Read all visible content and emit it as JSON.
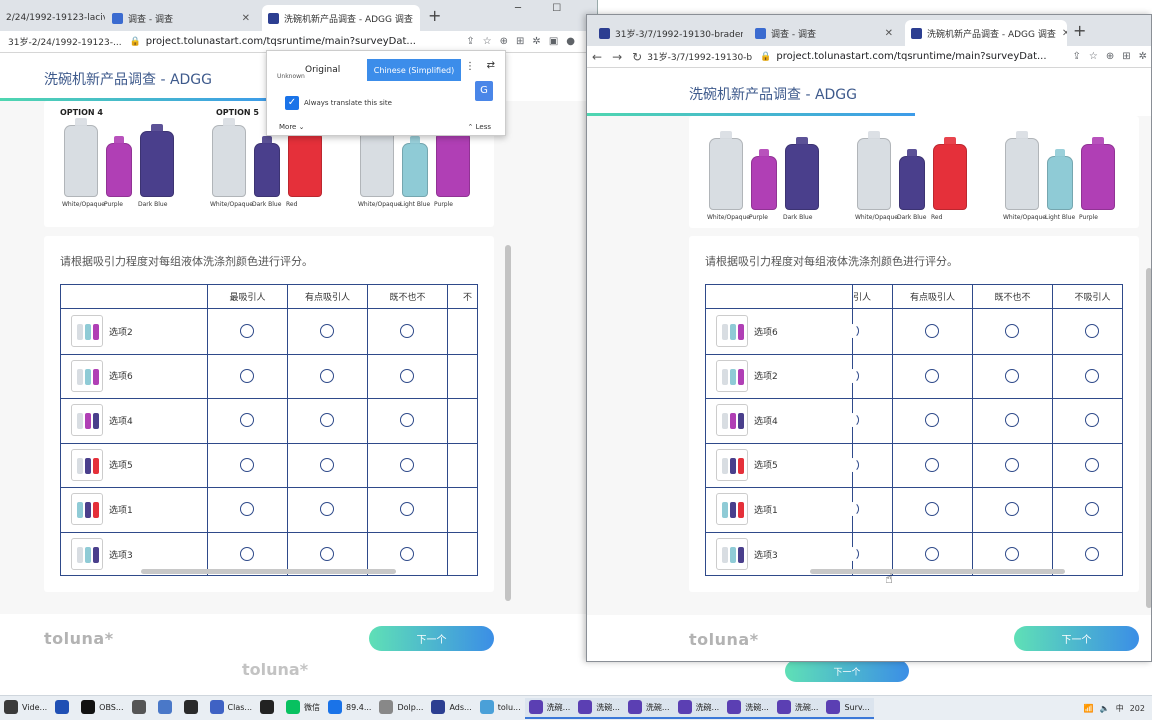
{
  "left_window": {
    "tabs": [
      {
        "title": "2/24/1992-19123-lacive..."
      },
      {
        "title": "调查 - 调查"
      },
      {
        "title": "洗碗机新产品调查 - ADGG 调查"
      }
    ],
    "address_prefix": "31岁-2/24/1992-19123-...",
    "url": "project.tolunastart.com/tqsruntime/main?surveyDat...",
    "survey_title": "洗碗机新产品调查 - ADGG",
    "translate_popup": {
      "original": "Original",
      "unknown": "Unknown",
      "target_language": "Chinese (Simplified)",
      "always_translate": "Always translate this site",
      "more": "More",
      "less": "Less"
    }
  },
  "right_window": {
    "tabs": [
      {
        "title": "31岁-3/7/1992-19130-braden..."
      },
      {
        "title": "调查 - 调查"
      },
      {
        "title": "洗碗机新产品调查 - ADGG 调查"
      }
    ],
    "address_prefix": "31岁-3/7/1992-19130-b",
    "url": "project.tolunastart.com/tqsruntime/main?surveyDat...",
    "survey_title": "洗碗机新产品调查 - ADGG"
  },
  "left_options": [
    {
      "label": "OPTION 4",
      "bottles": [
        {
          "name": "White/Opaque",
          "color": "#d8dde2"
        },
        {
          "name": "Purple",
          "color": "#b03fb5"
        },
        {
          "name": "Dark Blue",
          "color": "#4a3f8c"
        }
      ]
    },
    {
      "label": "OPTION 5",
      "bottles": [
        {
          "name": "White/Opaque",
          "color": "#d8dde2"
        },
        {
          "name": "Dark Blue",
          "color": "#4a3f8c"
        },
        {
          "name": "Red",
          "color": "#e5303a"
        }
      ]
    },
    {
      "label": "",
      "bottles": [
        {
          "name": "White/Opaque",
          "color": "#d8dde2"
        },
        {
          "name": "Light Blue",
          "color": "#8fcbd6"
        },
        {
          "name": "Purple",
          "color": "#b03fb5"
        }
      ]
    }
  ],
  "right_options": [
    {
      "bottles": [
        {
          "name": "White/Opaque",
          "color": "#d8dde2"
        },
        {
          "name": "Purple",
          "color": "#b03fb5"
        },
        {
          "name": "Dark Blue",
          "color": "#4a3f8c"
        }
      ]
    },
    {
      "bottles": [
        {
          "name": "White/Opaque",
          "color": "#d8dde2"
        },
        {
          "name": "Dark Blue",
          "color": "#4a3f8c"
        },
        {
          "name": "Red",
          "color": "#e5303a"
        }
      ]
    },
    {
      "bottles": [
        {
          "name": "White/Opaque",
          "color": "#d8dde2"
        },
        {
          "name": "Light Blue",
          "color": "#8fcbd6"
        },
        {
          "name": "Purple",
          "color": "#b03fb5"
        }
      ]
    }
  ],
  "question": "请根据吸引力程度对每组液体洗涤剂颜色进行评分。",
  "left_columns": [
    "最吸引人",
    "有点吸引人",
    "既不也不",
    "不"
  ],
  "right_columns": [
    "引人",
    "有点吸引人",
    "既不也不",
    "不吸引人"
  ],
  "left_rows": [
    "选项2",
    "选项6",
    "选项4",
    "选项5",
    "选项1",
    "选项3"
  ],
  "right_rows": [
    "选项6",
    "选项2",
    "选项4",
    "选项5",
    "选项1",
    "选项3"
  ],
  "logo": "toluna",
  "next_button": "下一个",
  "taskbar": [
    "Vide...",
    "",
    "OBS...",
    "",
    "",
    "",
    "Clas...",
    "",
    "微信",
    "89.4...",
    "Dolp...",
    "Ads...",
    "tolu...",
    "洗碗...",
    "洗碗...",
    "洗碗...",
    "洗碗...",
    "洗碗...",
    "洗碗...",
    "Surv..."
  ],
  "tray_year": "202"
}
